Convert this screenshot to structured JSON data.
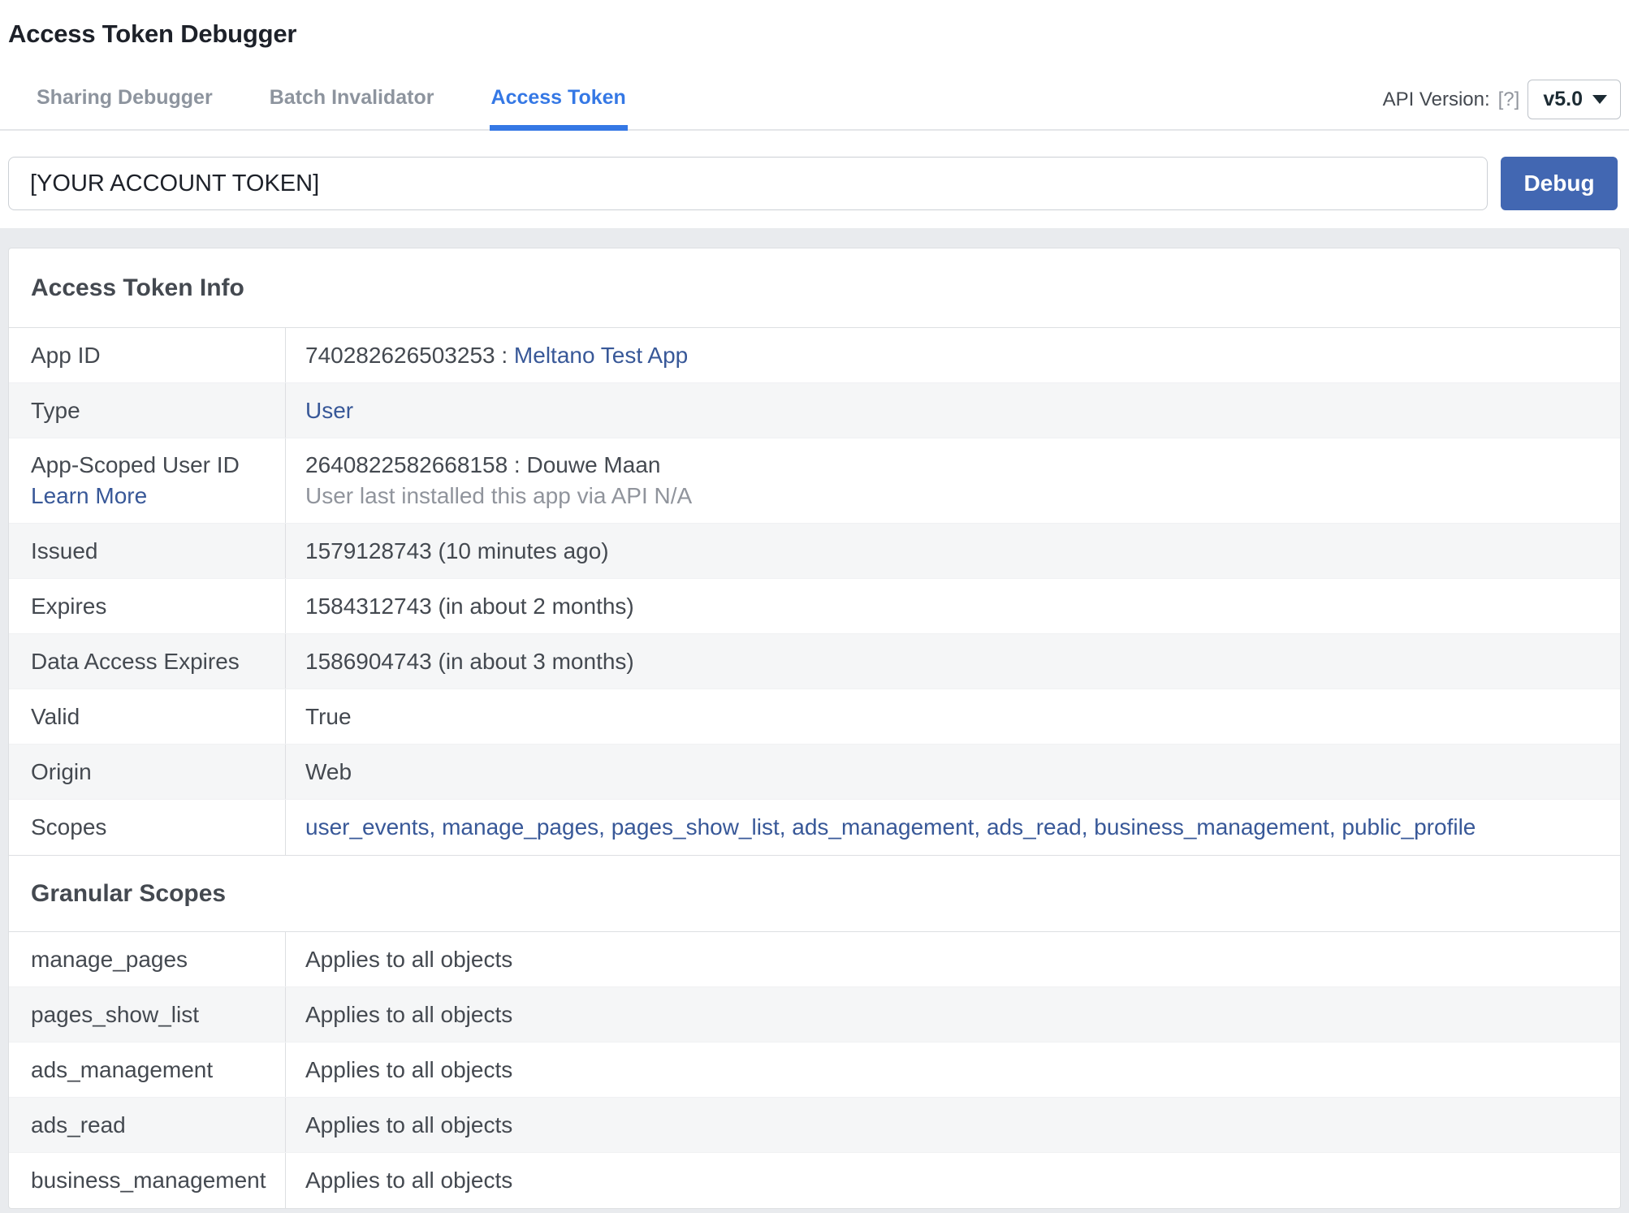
{
  "page": {
    "title": "Access Token Debugger"
  },
  "tabs": [
    {
      "label": "Sharing Debugger",
      "active": false
    },
    {
      "label": "Batch Invalidator",
      "active": false
    },
    {
      "label": "Access Token",
      "active": true
    }
  ],
  "api_version": {
    "label": "API Version:",
    "help": "[?]",
    "selected": "v5.0"
  },
  "token_form": {
    "input_value": "[YOUR ACCOUNT TOKEN]",
    "debug_label": "Debug"
  },
  "token_info": {
    "title": "Access Token Info",
    "rows": [
      {
        "label": "App ID",
        "value_text": "740282626503253 : ",
        "value_link": "Meltano Test App"
      },
      {
        "label": "Type",
        "value_link": "User"
      },
      {
        "label": "App-Scoped User ID",
        "label_link": "Learn More",
        "value": "2640822582668158 : Douwe Maan",
        "value_sub": "User last installed this app via API N/A"
      },
      {
        "label": "Issued",
        "value": "1579128743 (10 minutes ago)"
      },
      {
        "label": "Expires",
        "value": "1584312743 (in about 2 months)"
      },
      {
        "label": "Data Access Expires",
        "value": "1586904743 (in about 3 months)"
      },
      {
        "label": "Valid",
        "value": "True"
      },
      {
        "label": "Origin",
        "value": "Web"
      },
      {
        "label": "Scopes",
        "value_link": "user_events, manage_pages, pages_show_list, ads_management, ads_read, business_management, public_profile"
      }
    ]
  },
  "granular_scopes": {
    "title": "Granular Scopes",
    "rows": [
      {
        "label": "manage_pages",
        "value": "Applies to all objects"
      },
      {
        "label": "pages_show_list",
        "value": "Applies to all objects"
      },
      {
        "label": "ads_management",
        "value": "Applies to all objects"
      },
      {
        "label": "ads_read",
        "value": "Applies to all objects"
      },
      {
        "label": "business_management",
        "value": "Applies to all objects"
      }
    ]
  },
  "icons": {
    "chevron_down": "▼",
    "help": "[?]"
  },
  "colors": {
    "accent_tab_blue": "#3578e5",
    "button_blue": "#4267b2",
    "link_blue": "#385898",
    "page_background": "#e9ebee",
    "row_stripe": "#f5f6f7",
    "border": "#dddfe2",
    "text_dark": "#444950",
    "text_muted": "#90949c"
  }
}
